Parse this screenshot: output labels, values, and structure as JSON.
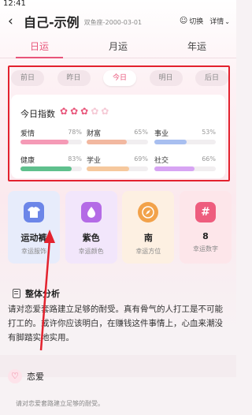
{
  "status_bar": {
    "time": "12:41"
  },
  "header": {
    "title": "自己-示例",
    "subtitle": "双鱼座-2000-03-01",
    "switch_label": "切换",
    "detail_label": "详情"
  },
  "tabs": [
    "日运",
    "月运",
    "年运"
  ],
  "active_tab": 0,
  "days": [
    "前日",
    "昨日",
    "今日",
    "明日",
    "后日"
  ],
  "active_day": 2,
  "today_index": {
    "label": "今日指数",
    "stars_filled": 3,
    "stars_total": 5,
    "metrics": [
      {
        "name": "爱情",
        "pct_label": "78%",
        "value": 0.78,
        "color": "#f59ab6"
      },
      {
        "name": "财富",
        "pct_label": "65%",
        "value": 0.65,
        "color": "#f2b8a0"
      },
      {
        "name": "事业",
        "pct_label": "53%",
        "value": 0.53,
        "color": "#a8bff0"
      },
      {
        "name": "健康",
        "pct_label": "83%",
        "value": 0.83,
        "color": "#5fc08d"
      },
      {
        "name": "学业",
        "pct_label": "69%",
        "value": 0.69,
        "color": "#f6c89d"
      },
      {
        "name": "社交",
        "pct_label": "66%",
        "value": 0.66,
        "color": "#d7a4f3"
      }
    ]
  },
  "tiles": [
    {
      "value": "运动裤",
      "label": "幸运服饰",
      "icon": "shirt-icon",
      "bg": "#e7ecfb",
      "icon_bg": "#6c86e8"
    },
    {
      "value": "紫色",
      "label": "幸运颜色",
      "icon": "drop-icon",
      "bg": "#f2e6fb",
      "icon_bg": "#b46be6"
    },
    {
      "value": "南",
      "label": "幸运方位",
      "icon": "compass-icon",
      "bg": "#fdf0e2",
      "icon_bg": "#f2a24a"
    },
    {
      "value": "8",
      "label": "幸运数字",
      "icon": "hash-icon",
      "bg": "#fde6ea",
      "icon_bg": "#ee5d7e"
    }
  ],
  "analysis": {
    "heading": "整体分析",
    "text": "请对恋爱套路建立足够的耐受。真有骨气的人打工是不可能打工的。或许你应该明白，在赚钱这件事情上，心血来潮没有脚踏实地实用。"
  },
  "love": {
    "heading": "恋爱",
    "text": "请对恋爱套路建立足够的耐受。"
  }
}
